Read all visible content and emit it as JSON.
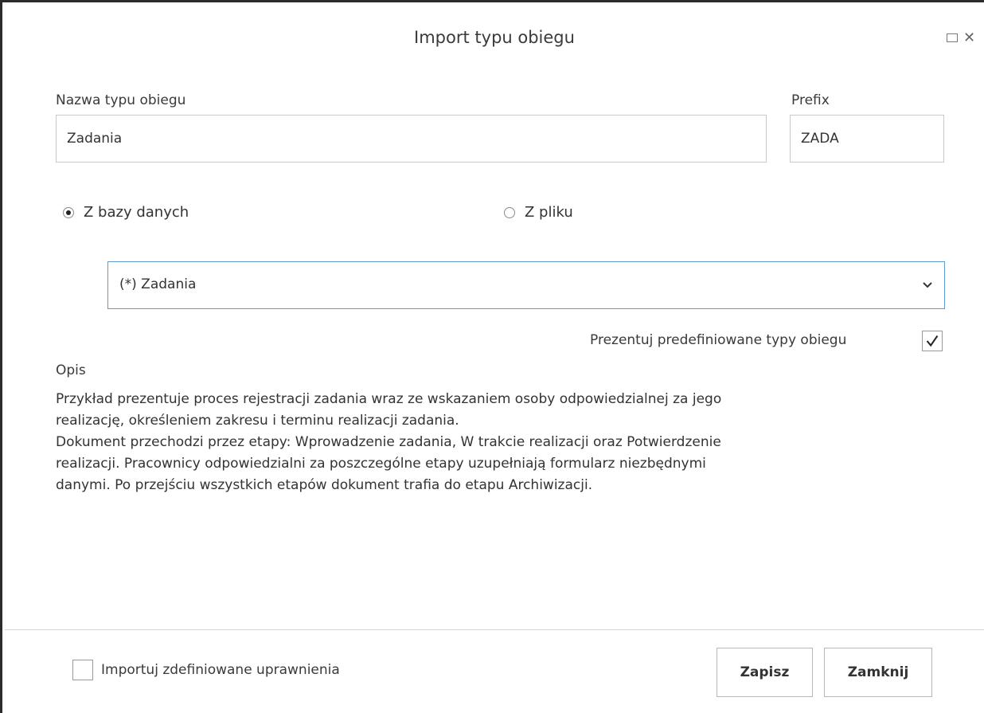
{
  "dialog": {
    "title": "Import typu obiegu",
    "maximize_icon": "maximize-icon",
    "close_icon": "close-icon",
    "close_glyph": "✕"
  },
  "form": {
    "name_label": "Nazwa typu obiegu",
    "name_value": "Zadania",
    "prefix_label": "Prefix",
    "prefix_value": "ZADA",
    "source_options": [
      {
        "label": "Z bazy danych",
        "selected": true
      },
      {
        "label": "Z pliku",
        "selected": false
      }
    ],
    "type_select": {
      "value": "(*) Zadania",
      "chevron_icon": "chevron-down-icon"
    },
    "show_predefined_label": "Prezentuj predefiniowane typy obiegu",
    "show_predefined_checked": true,
    "description_label": "Opis",
    "description_lines": [
      "Przykład prezentuje proces rejestracji zadania wraz ze wskazaniem osoby odpowiedzialnej za jego",
      "realizację, określeniem zakresu i terminu realizacji zadania.",
      "Dokument przechodzi przez etapy: Wprowadzenie zadania, W trakcie realizacji oraz Potwierdzenie",
      "realizacji. Pracownicy odpowiedzialni za poszczególne etapy uzupełniają formularz niezbędnymi",
      "danymi. Po przejściu wszystkich etapów dokument trafia do etapu Archiwizacji."
    ]
  },
  "footer": {
    "import_permissions_label": "Importuj zdefiniowane uprawnienia",
    "import_permissions_checked": false,
    "save_label": "Zapisz",
    "close_label": "Zamknij"
  },
  "colors": {
    "select_border": "#5b9bd5",
    "window_border": "#2b2b2b"
  }
}
